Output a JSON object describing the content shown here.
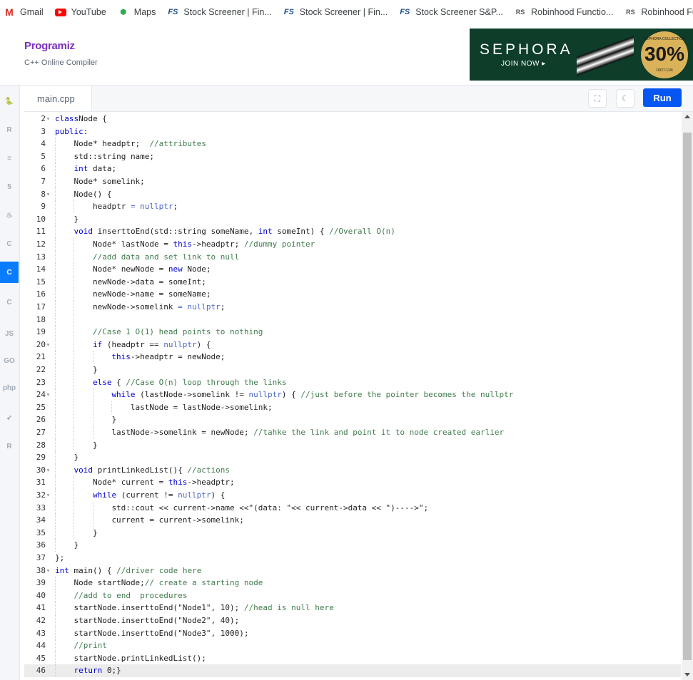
{
  "bookmarks": [
    {
      "label": "Gmail",
      "icon": "gmail-icon"
    },
    {
      "label": "YouTube",
      "icon": "youtube-icon"
    },
    {
      "label": "Maps",
      "icon": "maps-icon"
    },
    {
      "label": "Stock Screener | Fin...",
      "icon": "finviz-icon"
    },
    {
      "label": "Stock Screener | Fin...",
      "icon": "finviz-icon"
    },
    {
      "label": "Stock Screener S&P...",
      "icon": "finviz-icon"
    },
    {
      "label": "Robinhood Functio...",
      "icon": "rs-icon"
    },
    {
      "label": "Robinhood Functio...",
      "icon": "rs-icon"
    }
  ],
  "header": {
    "logo": "Programiz",
    "subtitle": "C++ Online Compiler"
  },
  "ad": {
    "brand": "SEPHORA",
    "cta": "JOIN NOW ▸",
    "badge_top": "SEPHORA COLLECTION",
    "badge_value": "30%",
    "badge_off": "OFF*",
    "badge_dates": "10/27-11/6"
  },
  "languages": [
    {
      "name": "python-icon",
      "label": "🐍"
    },
    {
      "name": "r-icon",
      "label": "R"
    },
    {
      "name": "sql-icon",
      "label": "≡"
    },
    {
      "name": "html-icon",
      "label": "5"
    },
    {
      "name": "java-icon",
      "label": "♨"
    },
    {
      "name": "c-icon",
      "label": "C"
    },
    {
      "name": "cpp-icon",
      "label": "C"
    },
    {
      "name": "csharp-icon",
      "label": "C"
    },
    {
      "name": "js-icon",
      "label": "JS"
    },
    {
      "name": "go-icon",
      "label": "GO"
    },
    {
      "name": "php-icon",
      "label": "php"
    },
    {
      "name": "swift-icon",
      "label": "➶"
    },
    {
      "name": "rust-icon",
      "label": "R"
    }
  ],
  "tab": {
    "label": "main.cpp"
  },
  "toolbar": {
    "run_label": "Run",
    "fullscreen_icon": "⛶",
    "theme_icon": "☾"
  },
  "code_lines": [
    {
      "n": "2",
      "fold": true,
      "indent": 0,
      "tokens": [
        [
          "kw",
          "class"
        ],
        [
          "",
          "Node {"
        ]
      ]
    },
    {
      "n": "3",
      "fold": false,
      "indent": 0,
      "tokens": [
        [
          "kw",
          "public:"
        ]
      ]
    },
    {
      "n": "4",
      "fold": false,
      "indent": 1,
      "tokens": [
        [
          "",
          "Node* headptr;  "
        ],
        [
          "cm",
          "//attributes"
        ]
      ]
    },
    {
      "n": "5",
      "fold": false,
      "indent": 1,
      "tokens": [
        [
          "",
          "std::string name;"
        ]
      ]
    },
    {
      "n": "6",
      "fold": false,
      "indent": 1,
      "tokens": [
        [
          "kw",
          "int"
        ],
        [
          "",
          " data;"
        ]
      ]
    },
    {
      "n": "7",
      "fold": false,
      "indent": 1,
      "tokens": [
        [
          "",
          "Node* somelink;"
        ]
      ]
    },
    {
      "n": "8",
      "fold": true,
      "indent": 1,
      "tokens": [
        [
          "",
          "Node() {"
        ]
      ]
    },
    {
      "n": "9",
      "fold": false,
      "indent": 2,
      "tokens": [
        [
          "",
          "headptr "
        ],
        [
          "nul",
          "= nullptr"
        ],
        [
          "",
          ";"
        ]
      ]
    },
    {
      "n": "10",
      "fold": false,
      "indent": 1,
      "tokens": [
        [
          "",
          "}"
        ]
      ]
    },
    {
      "n": "11",
      "fold": false,
      "indent": 1,
      "tokens": [
        [
          "kw",
          "void"
        ],
        [
          "",
          " inserttoEnd(std::string someName, "
        ],
        [
          "kw",
          "int"
        ],
        [
          "",
          " someInt) { "
        ],
        [
          "cm",
          "//Overall O(n)"
        ]
      ]
    },
    {
      "n": "12",
      "fold": false,
      "indent": 2,
      "tokens": [
        [
          "",
          "Node* lastNode = "
        ],
        [
          "kw",
          "this"
        ],
        [
          "",
          "->headptr; "
        ],
        [
          "cm",
          "//dummy pointer"
        ]
      ]
    },
    {
      "n": "13",
      "fold": false,
      "indent": 2,
      "tokens": [
        [
          "cm",
          "//add data and set link to null"
        ]
      ]
    },
    {
      "n": "14",
      "fold": false,
      "indent": 2,
      "tokens": [
        [
          "",
          "Node* newNode = "
        ],
        [
          "kw",
          "new"
        ],
        [
          "",
          " Node;"
        ]
      ]
    },
    {
      "n": "15",
      "fold": false,
      "indent": 2,
      "tokens": [
        [
          "",
          "newNode->data = someInt;"
        ]
      ]
    },
    {
      "n": "16",
      "fold": false,
      "indent": 2,
      "tokens": [
        [
          "",
          "newNode->name = someName;"
        ]
      ]
    },
    {
      "n": "17",
      "fold": false,
      "indent": 2,
      "tokens": [
        [
          "",
          "newNode->somelink "
        ],
        [
          "nul",
          "= nullptr"
        ],
        [
          "",
          ";"
        ]
      ]
    },
    {
      "n": "18",
      "fold": false,
      "indent": 2,
      "tokens": []
    },
    {
      "n": "19",
      "fold": false,
      "indent": 2,
      "tokens": [
        [
          "cm",
          "//Case 1 O(1) head points to nothing"
        ]
      ]
    },
    {
      "n": "20",
      "fold": true,
      "indent": 2,
      "tokens": [
        [
          "kw",
          "if"
        ],
        [
          "",
          " (headptr == "
        ],
        [
          "nul",
          "nullptr"
        ],
        [
          "",
          ") {"
        ]
      ]
    },
    {
      "n": "21",
      "fold": false,
      "indent": 3,
      "tokens": [
        [
          "kw",
          "this"
        ],
        [
          "",
          "->headptr = newNode;"
        ]
      ]
    },
    {
      "n": "22",
      "fold": false,
      "indent": 2,
      "tokens": [
        [
          "",
          "}"
        ]
      ]
    },
    {
      "n": "23",
      "fold": false,
      "indent": 2,
      "tokens": [
        [
          "kw",
          "else"
        ],
        [
          "",
          " { "
        ],
        [
          "cm",
          "//Case O(n) loop through the links"
        ]
      ]
    },
    {
      "n": "24",
      "fold": true,
      "indent": 3,
      "tokens": [
        [
          "kw",
          "while"
        ],
        [
          "",
          " (lastNode->somelink != "
        ],
        [
          "nul",
          "nullptr"
        ],
        [
          "",
          ") { "
        ],
        [
          "cm",
          "//just before the pointer becomes the nullptr"
        ]
      ]
    },
    {
      "n": "25",
      "fold": false,
      "indent": 4,
      "tokens": [
        [
          "",
          "lastNode = lastNode->somelink;"
        ]
      ]
    },
    {
      "n": "26",
      "fold": false,
      "indent": 3,
      "tokens": [
        [
          "",
          "}"
        ]
      ]
    },
    {
      "n": "27",
      "fold": false,
      "indent": 3,
      "tokens": [
        [
          "",
          "lastNode->somelink = newNode; "
        ],
        [
          "cm",
          "//tahke the link and point it to node created earlier"
        ]
      ]
    },
    {
      "n": "28",
      "fold": false,
      "indent": 2,
      "tokens": [
        [
          "",
          "}"
        ]
      ]
    },
    {
      "n": "29",
      "fold": false,
      "indent": 1,
      "tokens": [
        [
          "",
          "}"
        ]
      ]
    },
    {
      "n": "30",
      "fold": true,
      "indent": 1,
      "tokens": [
        [
          "kw",
          "void"
        ],
        [
          "",
          " printLinkedList(){ "
        ],
        [
          "cm",
          "//actions"
        ]
      ]
    },
    {
      "n": "31",
      "fold": false,
      "indent": 2,
      "tokens": [
        [
          "",
          "Node* current = "
        ],
        [
          "kw",
          "this"
        ],
        [
          "",
          "->headptr;"
        ]
      ]
    },
    {
      "n": "32",
      "fold": true,
      "indent": 2,
      "tokens": [
        [
          "kw",
          "while"
        ],
        [
          "",
          " (current != "
        ],
        [
          "nul",
          "nullptr"
        ],
        [
          "",
          ") {"
        ]
      ]
    },
    {
      "n": "33",
      "fold": false,
      "indent": 3,
      "tokens": [
        [
          "",
          "std::cout << current->name <<\"(data: \"<< current->data << \")---->\";"
        ]
      ]
    },
    {
      "n": "34",
      "fold": false,
      "indent": 3,
      "tokens": [
        [
          "",
          "current = current->somelink;"
        ]
      ]
    },
    {
      "n": "35",
      "fold": false,
      "indent": 2,
      "tokens": [
        [
          "",
          "}"
        ]
      ]
    },
    {
      "n": "36",
      "fold": false,
      "indent": 1,
      "tokens": [
        [
          "",
          "}"
        ]
      ]
    },
    {
      "n": "37",
      "fold": false,
      "indent": 0,
      "tokens": [
        [
          "",
          "};"
        ]
      ]
    },
    {
      "n": "38",
      "fold": true,
      "indent": 0,
      "tokens": [
        [
          "kw",
          "int"
        ],
        [
          "",
          " main() { "
        ],
        [
          "cm",
          "//driver code here"
        ]
      ]
    },
    {
      "n": "39",
      "fold": false,
      "indent": 1,
      "tokens": [
        [
          "",
          "Node startNode;"
        ],
        [
          "cm",
          "// create a starting node"
        ]
      ]
    },
    {
      "n": "40",
      "fold": false,
      "indent": 1,
      "tokens": [
        [
          "cm",
          "//add to end  procedures"
        ]
      ]
    },
    {
      "n": "41",
      "fold": false,
      "indent": 1,
      "tokens": [
        [
          "",
          "startNode.inserttoEnd(\"Node1\", 10); "
        ],
        [
          "cm",
          "//head is null here"
        ]
      ]
    },
    {
      "n": "42",
      "fold": false,
      "indent": 1,
      "tokens": [
        [
          "",
          "startNode.inserttoEnd(\"Node2\", 40);"
        ]
      ]
    },
    {
      "n": "43",
      "fold": false,
      "indent": 1,
      "tokens": [
        [
          "",
          "startNode.inserttoEnd(\"Node3\", 1000);"
        ]
      ]
    },
    {
      "n": "44",
      "fold": false,
      "indent": 1,
      "tokens": [
        [
          "cm",
          "//print"
        ]
      ]
    },
    {
      "n": "45",
      "fold": false,
      "indent": 1,
      "tokens": [
        [
          "",
          "startNode.printLinkedList();"
        ]
      ]
    },
    {
      "n": "46",
      "fold": false,
      "indent": 1,
      "active": true,
      "tokens": [
        [
          "kw",
          "return"
        ],
        [
          "",
          " 0;}"
        ]
      ]
    }
  ]
}
